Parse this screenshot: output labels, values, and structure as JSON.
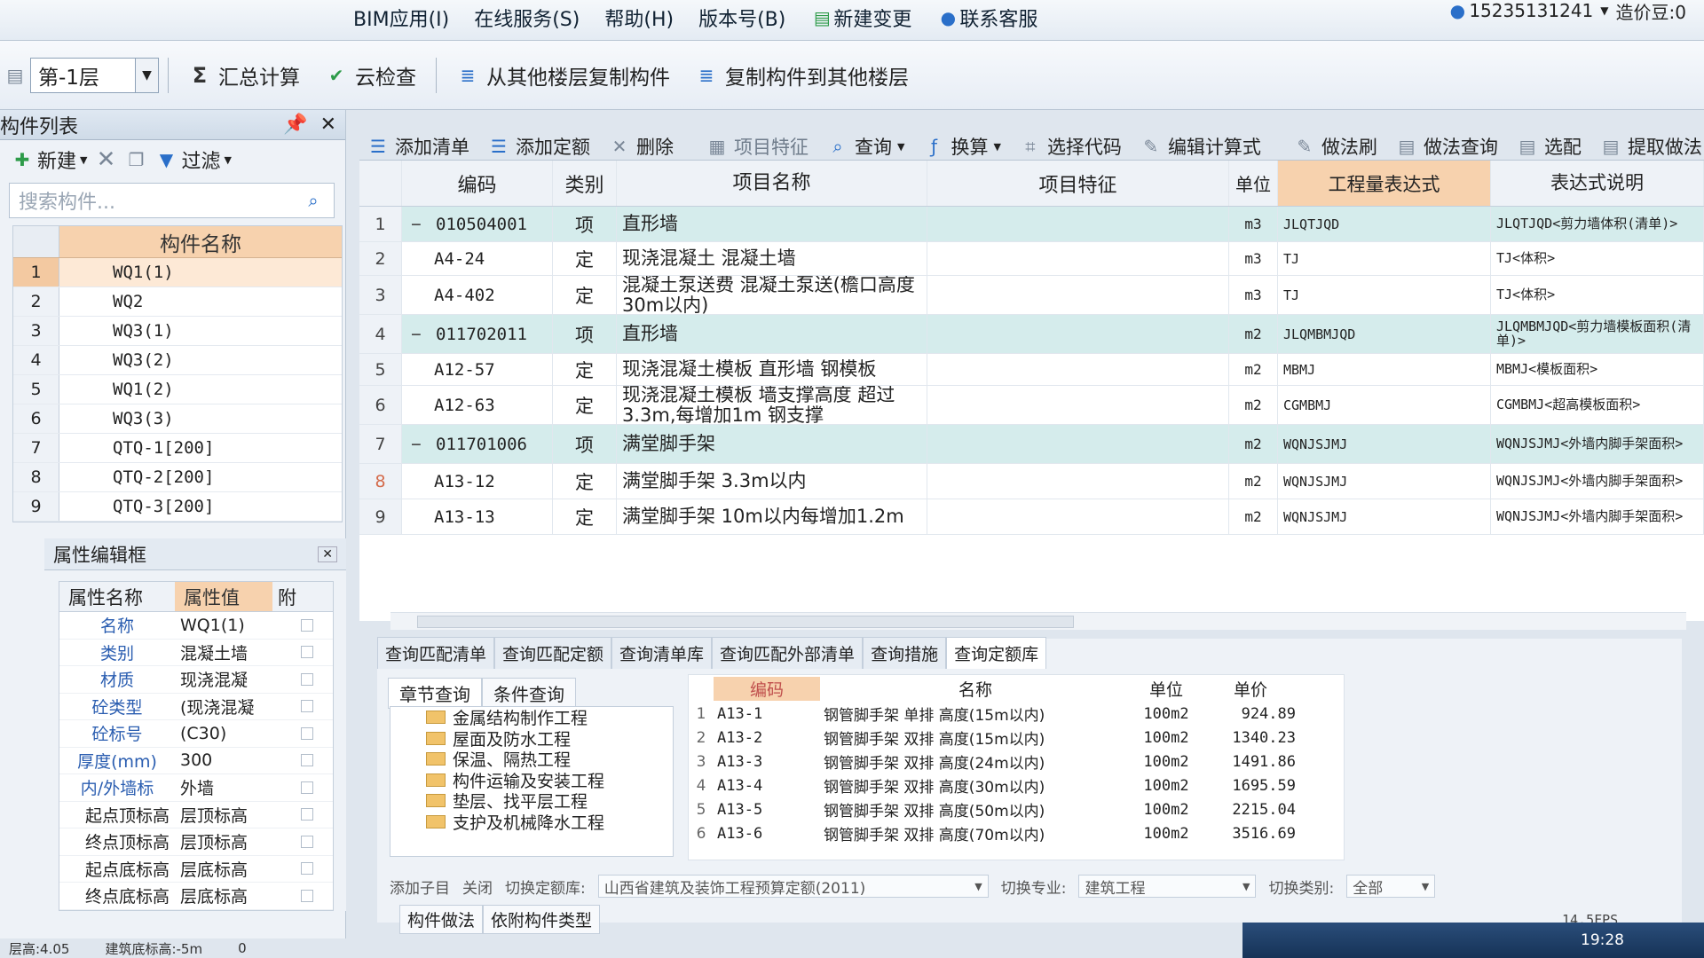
{
  "menubar": {
    "items": [
      "BIM应用(I)",
      "在线服务(S)",
      "帮助(H)",
      "版本号(B)",
      "新建变更",
      "联系客服"
    ],
    "account": "15235131241",
    "cost_beans": "造价豆:0"
  },
  "toolbar": {
    "floor": "第-1层",
    "sum_calc": "汇总计算",
    "cloud_check": "云检查",
    "copy_from_floor": "从其他楼层复制构件",
    "copy_to_floor": "复制构件到其他楼层"
  },
  "component_panel": {
    "title": "构件列表",
    "new_label": "新建",
    "filter_label": "过滤",
    "search_placeholder": "搜索构件...",
    "column": "构件名称",
    "items": [
      {
        "n": "1",
        "name": "WQ1(1)"
      },
      {
        "n": "2",
        "name": "WQ2"
      },
      {
        "n": "3",
        "name": "WQ3(1)"
      },
      {
        "n": "4",
        "name": "WQ3(2)"
      },
      {
        "n": "5",
        "name": "WQ1(2)"
      },
      {
        "n": "6",
        "name": "WQ3(3)"
      },
      {
        "n": "7",
        "name": "QTQ-1[200]"
      },
      {
        "n": "8",
        "name": "QTQ-2[200]"
      },
      {
        "n": "9",
        "name": "QTQ-3[200]"
      }
    ]
  },
  "property_panel": {
    "title": "属性编辑框",
    "col_name": "属性名称",
    "col_value": "属性值",
    "col_attach": "附",
    "rows": [
      {
        "name": "名称",
        "value": "WQ1(1)",
        "blue": true
      },
      {
        "name": "类别",
        "value": "混凝土墙",
        "blue": true
      },
      {
        "name": "材质",
        "value": "现浇混凝",
        "blue": true
      },
      {
        "name": "砼类型",
        "value": "(现浇混凝",
        "blue": true
      },
      {
        "name": "砼标号",
        "value": "(C30)",
        "blue": true
      },
      {
        "name": "厚度(mm)",
        "value": "300",
        "blue": true
      },
      {
        "name": "内/外墙标",
        "value": "外墙",
        "blue": true
      },
      {
        "name": "起点顶标高",
        "value": "层顶标高",
        "blue": false
      },
      {
        "name": "终点顶标高",
        "value": "层顶标高",
        "blue": false
      },
      {
        "name": "起点底标高",
        "value": "层底标高",
        "blue": false
      },
      {
        "name": "终点底标高",
        "value": "层底标高",
        "blue": false
      }
    ]
  },
  "main_toolbar": {
    "add_list": "添加清单",
    "add_quota": "添加定额",
    "delete": "删除",
    "item_feature": "项目特征",
    "query": "查询",
    "convert": "换算",
    "select_code": "选择代码",
    "edit_formula": "编辑计算式",
    "method_lib": "做法刷",
    "method_query": "做法查询",
    "select_match": "选配",
    "extract_method": "提取做法"
  },
  "grid": {
    "headers": {
      "code": "编码",
      "kind": "类别",
      "name": "项目名称",
      "feature": "项目特征",
      "unit": "单位",
      "expr": "工程量表达式",
      "desc": "表达式说明"
    },
    "rows": [
      {
        "n": "1",
        "code": "010504001",
        "kind": "项",
        "name": "直形墙",
        "unit": "m3",
        "expr": "JLQTJQD",
        "desc": "JLQTJQD<剪力墙体积(清单)>",
        "item": true
      },
      {
        "n": "2",
        "code": "A4-24",
        "kind": "定",
        "name": "现浇混凝土 混凝土墙",
        "unit": "m3",
        "expr": "TJ",
        "desc": "TJ<体积>",
        "item": false
      },
      {
        "n": "3",
        "code": "A4-402",
        "kind": "定",
        "name": "混凝土泵送费 混凝土泵送(檐口高度30m以内)",
        "unit": "m3",
        "expr": "TJ",
        "desc": "TJ<体积>",
        "item": false
      },
      {
        "n": "4",
        "code": "011702011",
        "kind": "项",
        "name": "直形墙",
        "unit": "m2",
        "expr": "JLQMBMJQD",
        "desc": "JLQMBMJQD<剪力墙模板面积(清单)>",
        "item": true
      },
      {
        "n": "5",
        "code": "A12-57",
        "kind": "定",
        "name": "现浇混凝土模板 直形墙 钢模板",
        "unit": "m2",
        "expr": "MBMJ",
        "desc": "MBMJ<模板面积>",
        "item": false
      },
      {
        "n": "6",
        "code": "A12-63",
        "kind": "定",
        "name": "现浇混凝土模板 墙支撑高度 超过3.3m,每增加1m 钢支撑",
        "unit": "m2",
        "expr": "CGMBMJ",
        "desc": "CGMBMJ<超高模板面积>",
        "item": false
      },
      {
        "n": "7",
        "code": "011701006",
        "kind": "项",
        "name": "满堂脚手架",
        "unit": "m2",
        "expr": "WQNJSJMJ",
        "desc": "WQNJSJMJ<外墙内脚手架面积>",
        "item": true
      },
      {
        "n": "8",
        "code": "A13-12",
        "kind": "定",
        "name": "满堂脚手架 3.3m以内",
        "unit": "m2",
        "expr": "WQNJSJMJ",
        "desc": "WQNJSJMJ<外墙内脚手架面积>",
        "item": false
      },
      {
        "n": "9",
        "code": "A13-13",
        "kind": "定",
        "name": "满堂脚手架 10m以内每增加1.2m",
        "unit": "m2",
        "expr": "WQNJSJMJ",
        "desc": "WQNJSJMJ<外墙内脚手架面积>",
        "item": false
      }
    ]
  },
  "query_panel": {
    "tabs": [
      "查询匹配清单",
      "查询匹配定额",
      "查询清单库",
      "查询匹配外部清单",
      "查询措施",
      "查询定额库"
    ],
    "subtabs": [
      "章节查询",
      "条件查询"
    ],
    "tree": [
      "金属结构制作工程",
      "屋面及防水工程",
      "保温、隔热工程",
      "构件运输及安装工程",
      "垫层、找平层工程",
      "支护及机械降水工程"
    ],
    "result_headers": {
      "code": "编码",
      "name": "名称",
      "unit": "单位",
      "price": "单价"
    },
    "results": [
      {
        "n": "1",
        "code": "A13-1",
        "name": "钢管脚手架 单排 高度(15m以内)",
        "unit": "100m2",
        "price": "924.89"
      },
      {
        "n": "2",
        "code": "A13-2",
        "name": "钢管脚手架 双排 高度(15m以内)",
        "unit": "100m2",
        "price": "1340.23"
      },
      {
        "n": "3",
        "code": "A13-3",
        "name": "钢管脚手架 双排 高度(24m以内)",
        "unit": "100m2",
        "price": "1491.86"
      },
      {
        "n": "4",
        "code": "A13-4",
        "name": "钢管脚手架 双排 高度(30m以内)",
        "unit": "100m2",
        "price": "1695.59"
      },
      {
        "n": "5",
        "code": "A13-5",
        "name": "钢管脚手架 双排 高度(50m以内)",
        "unit": "100m2",
        "price": "2215.04"
      },
      {
        "n": "6",
        "code": "A13-6",
        "name": "钢管脚手架 双排 高度(70m以内)",
        "unit": "100m2",
        "price": "3516.69"
      }
    ],
    "footer": {
      "add_sub": "添加子目",
      "close": "关闭",
      "switch_lib_label": "切换定额库:",
      "switch_lib_value": "山西省建筑及装饰工程预算定额(2011)",
      "switch_major_label": "切换专业:",
      "switch_major_value": "建筑工程",
      "switch_type_label": "切换类别:",
      "switch_type_value": "全部"
    }
  },
  "bottom_tabs": [
    "构件做法",
    "依附构件类型"
  ],
  "fps": "14.5FPS",
  "status": {
    "left": "层高:4.05",
    "mid": "建筑底标高:-5m",
    "right": "0"
  },
  "clock": "19:28"
}
